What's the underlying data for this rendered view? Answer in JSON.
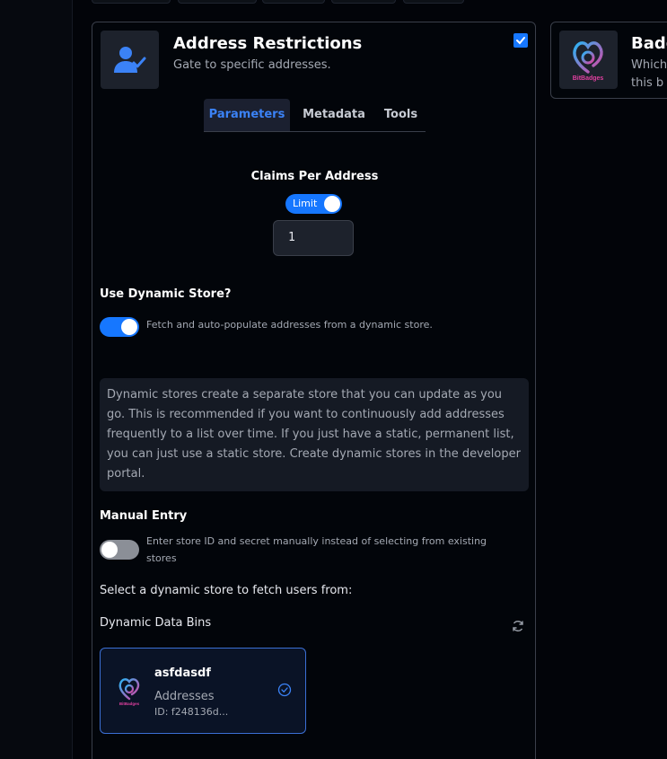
{
  "card": {
    "title": "Address Restrictions",
    "subtitle": "Gate to specific addresses.",
    "icon": "user-check-icon",
    "selected": true
  },
  "tabs": [
    {
      "label": "Parameters",
      "active": true
    },
    {
      "label": "Metadata",
      "active": false
    },
    {
      "label": "Tools",
      "active": false
    }
  ],
  "claims": {
    "label": "Claims Per Address",
    "toggle_label": "Limit",
    "toggle_on": true,
    "value": "1"
  },
  "dynamic_store": {
    "label": "Use Dynamic Store?",
    "enabled": true,
    "description": "Fetch and auto-populate addresses from a dynamic store.",
    "info": "Dynamic stores create a separate store that you can update as you go. This is recommended if you want to continuously add addresses frequently to a list over time. If you just have a static, permanent list, you can just use a static store. Create dynamic stores in the developer portal."
  },
  "manual_entry": {
    "label": "Manual Entry",
    "enabled": false,
    "description_line1": "Enter store ID and secret manually instead of selecting from existing",
    "description_line2": "stores"
  },
  "select_prompt": "Select a dynamic store to fetch users from:",
  "bins": {
    "heading": "Dynamic Data Bins",
    "items": [
      {
        "name": "asfdasdf",
        "type": "Addresses",
        "id": "ID: f248136d...",
        "selected": true,
        "logo_text": "BitBadges"
      }
    ]
  },
  "side_card": {
    "title": "Badg",
    "subtitle_line1": "Which",
    "subtitle_line2": "this b",
    "logo_text": "BitBadges"
  },
  "colors": {
    "accent": "#1677ff",
    "active_tab": "#3b82f6",
    "background": "#02050a"
  }
}
